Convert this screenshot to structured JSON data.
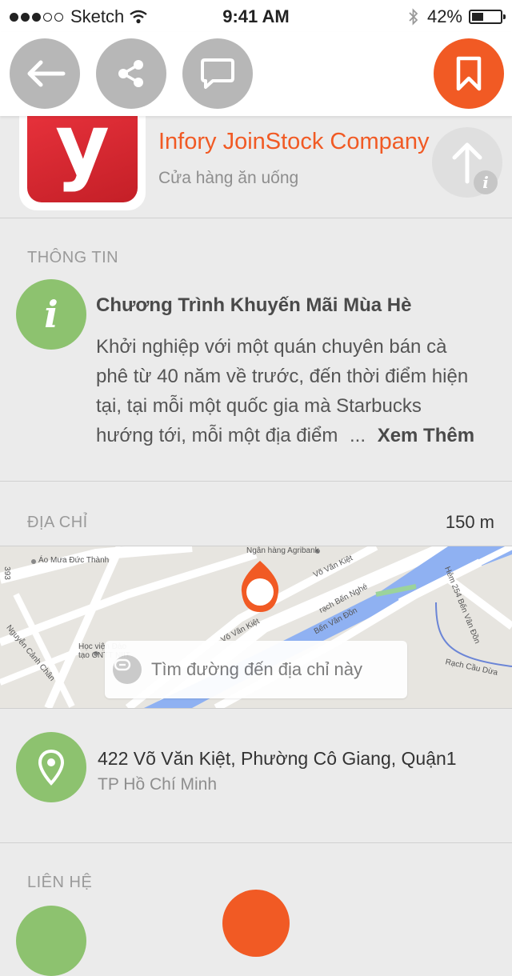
{
  "status_bar": {
    "carrier": "Sketch",
    "time": "9:41 AM",
    "battery": "42%",
    "battery_level": 0.42
  },
  "nav": {
    "back_icon": "back-arrow-icon",
    "share_icon": "share-icon",
    "comment_icon": "comment-icon",
    "bookmark_icon": "bookmark-icon",
    "accent_color": "#f15a24",
    "button_color": "#b7b7b7"
  },
  "company": {
    "logo_letter": "y",
    "name": "Infory JoinStock Company",
    "category": "Cửa hàng ăn uống"
  },
  "info": {
    "section_title": "THÔNG TIN",
    "promo_title": "Chương Trình Khuyến Mãi Mùa Hè",
    "promo_desc": "Khởi nghiệp với một quán chuyên bán cà phê từ 40 năm về trước, đến thời điểm hiện tại, tại mỗi một quốc gia mà Starbucks hướng tới, mỗi một địa điểm",
    "ellipsis": "...",
    "read_more": "Xem Thêm"
  },
  "address": {
    "section_title": "ĐỊA CHỈ",
    "distance": "150 m",
    "map_labels": {
      "bank": "Ngân hàng Agribank",
      "shop": "Áo Mưa Đức Thành",
      "street1": "Võ Văn Kiệt",
      "street2": "Võ Văn Kiệt",
      "canal": "rạch Bến Nghé",
      "wharf": "Bến Vân Đồn",
      "alley": "Hẻm 254 Bến Vân Đồn",
      "cau_dua": "Rạch Cầu Dừa",
      "school": "Học viện Đào tạo CNTT NIIT",
      "canh_chan": "Nguyễn Cảnh Chân",
      "num": "393"
    },
    "route_text": "Tìm đường đến địa chỉ này",
    "line1": "422 Võ Văn Kiệt, Phường Cô Giang, Quận1",
    "line2": "TP Hồ Chí Minh"
  },
  "contact": {
    "section_title": "LIÊN HỆ"
  }
}
